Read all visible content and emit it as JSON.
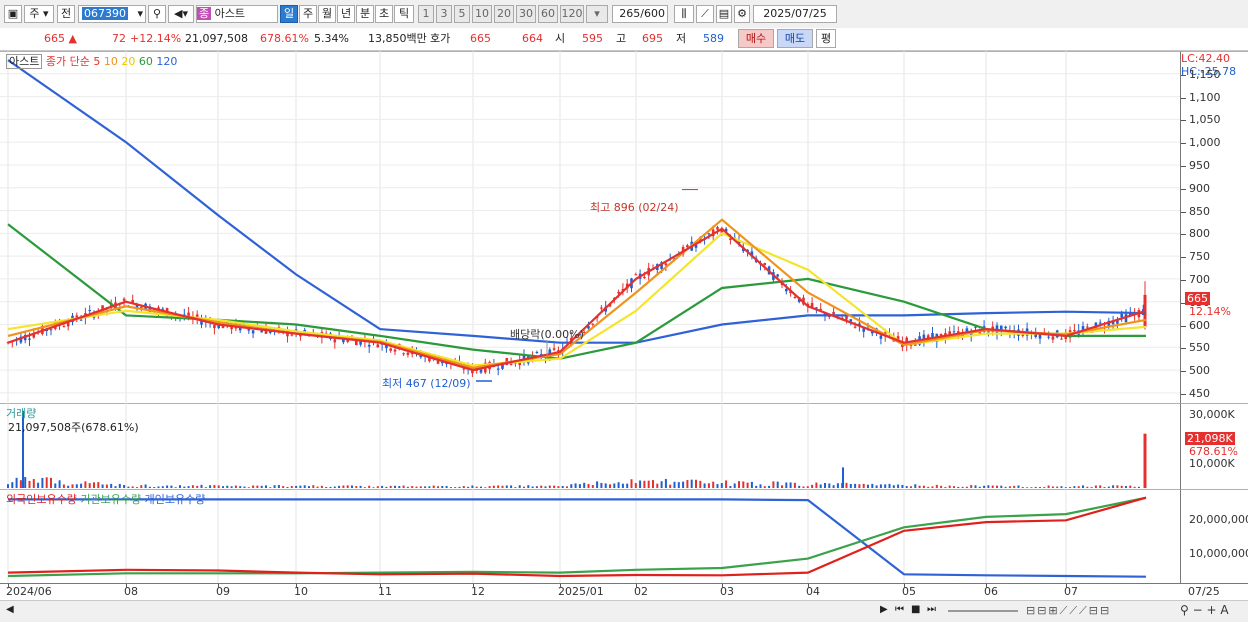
{
  "toolbar": {
    "period_label": "주",
    "prev_label": "전",
    "stock_code": "067390",
    "stock_name": "아스트",
    "stock_badge": "종",
    "tabs": [
      "일",
      "주",
      "월",
      "년",
      "분",
      "초",
      "틱"
    ],
    "active_tab": "일",
    "periods": [
      "1",
      "3",
      "5",
      "10",
      "20",
      "30",
      "60",
      "120"
    ],
    "count": "265",
    "count_total": "/600",
    "date": "2025/07/25"
  },
  "info": {
    "price": "665",
    "arrow": "▲",
    "change": "72",
    "change_pct": "+12.14%",
    "volume": "21,097,508",
    "volume_pct": "678.61%",
    "turnover": "5.34%",
    "amount": "13,850백만",
    "quote_label": "호가",
    "ask": "665",
    "bid": "664",
    "open_label": "시",
    "open": "595",
    "high_label": "고",
    "high": "695",
    "low_label": "저",
    "low": "589",
    "buy_label": "매수",
    "sell_label": "매도",
    "avg_label": "평"
  },
  "price_pane": {
    "name_label": "아스트",
    "series_label": "종가 단순",
    "ma_labels": [
      "5",
      "10",
      "20",
      "60",
      "120"
    ],
    "max_annotation": "최고 896 (02/24)",
    "min_annotation": "최저 467 (12/09)",
    "dividend_annotation": "배당락(0.00%)",
    "lc_label": "LC:42.40",
    "hc_label": "HC:-25.78",
    "price_tag": "665",
    "pct_tag": "12.14%",
    "y_labels": [
      "1,150",
      "1,100",
      "1,050",
      "1,000",
      "950",
      "900",
      "850",
      "800",
      "750",
      "700",
      "650",
      "600",
      "550",
      "500",
      "450"
    ]
  },
  "volume_pane": {
    "title": "거래량",
    "value_label": "21,097,508주(678.61%)",
    "tag_value": "21,098K",
    "tag_pct": "678.61%",
    "y_labels": [
      "30,000K",
      "10,000K"
    ]
  },
  "holdings_pane": {
    "legend": [
      "외국인보유수량",
      "기관보유수량",
      "개인보유수량"
    ],
    "y_labels": [
      "20,000,000",
      "10,000,000"
    ]
  },
  "x_axis": {
    "labels": [
      "2024/06",
      "08",
      "09",
      "10",
      "11",
      "12",
      "2025/01",
      "02",
      "03",
      "04",
      "05",
      "06",
      "07",
      "07/25"
    ]
  },
  "colors": {
    "up": "#e4312f",
    "down": "#1f5fd1",
    "ma5": "#e4312f",
    "ma10": "#f0931d",
    "ma20": "#f5e42b",
    "ma60": "#2a9a3a",
    "ma120": "#2f62d6",
    "foreign": "#e0201c",
    "institution": "#3ba24a",
    "individual": "#2f62d6"
  },
  "chart_data": [
    {
      "type": "line",
      "title": "아스트",
      "y_scale": "price (KRW)",
      "ylim": [
        430,
        1200
      ],
      "x": [
        "2024/06",
        "2024/08",
        "2024/09",
        "2024/10",
        "2024/11",
        "2024/12",
        "2025/01",
        "2025/02",
        "2025/03",
        "2025/04",
        "2025/05",
        "2025/06",
        "2025/07",
        "2025/07/25"
      ],
      "series": [
        {
          "name": "5",
          "values": [
            560,
            650,
            600,
            580,
            560,
            500,
            540,
            700,
            810,
            640,
            560,
            590,
            575,
            630
          ]
        },
        {
          "name": "10",
          "values": [
            575,
            640,
            605,
            580,
            562,
            505,
            535,
            670,
            830,
            670,
            555,
            588,
            578,
            610
          ]
        },
        {
          "name": "20",
          "values": [
            590,
            630,
            610,
            585,
            565,
            510,
            525,
            630,
            800,
            720,
            555,
            580,
            580,
            595
          ]
        },
        {
          "name": "60",
          "values": [
            820,
            620,
            610,
            600,
            575,
            545,
            525,
            560,
            680,
            700,
            650,
            590,
            575,
            575
          ]
        },
        {
          "name": "120",
          "values": [
            1180,
            1000,
            840,
            710,
            590,
            575,
            560,
            560,
            600,
            620,
            620,
            625,
            628,
            625
          ]
        }
      ],
      "annotations": [
        {
          "label": "최고 896 (02/24)",
          "x": "2025/02/24",
          "y": 896
        },
        {
          "label": "최저 467 (12/09)",
          "x": "2024/12/09",
          "y": 467
        },
        {
          "label": "배당락(0.00%)",
          "x": "2024/12/27",
          "y": 545
        }
      ]
    },
    {
      "type": "bar",
      "title": "거래량",
      "ylim": [
        0,
        33000
      ],
      "unit": "K",
      "x": [
        "2024/06",
        "2024/08",
        "2024/09",
        "2024/10",
        "2024/11",
        "2024/12",
        "2025/01",
        "2025/02",
        "2025/03",
        "2025/04",
        "2025/05",
        "2025/06",
        "2025/07",
        "2025/07/25"
      ],
      "values": [
        3200,
        900,
        700,
        700,
        600,
        600,
        700,
        2600,
        1800,
        1400,
        900,
        700,
        600,
        21098
      ]
    },
    {
      "type": "line",
      "title": "보유수량",
      "ylim": [
        0,
        25000000
      ],
      "x": [
        "2024/06",
        "2024/08",
        "2024/09",
        "2024/10",
        "2024/11",
        "2024/12",
        "2025/01",
        "2025/02",
        "2025/03",
        "2025/04",
        "2025/05",
        "2025/06",
        "2025/07",
        "2025/07/25"
      ],
      "series": [
        {
          "name": "외국인보유수량",
          "values": [
            3000000,
            3800000,
            3600000,
            3000000,
            2500000,
            2700000,
            2000000,
            2300000,
            2200000,
            3000000,
            15000000,
            17500000,
            18000000,
            24500000
          ]
        },
        {
          "name": "기관보유수량",
          "values": [
            2000000,
            2800000,
            2800000,
            2800000,
            3000000,
            3200000,
            3000000,
            3800000,
            4300000,
            7000000,
            16000000,
            19000000,
            19800000,
            24500000
          ]
        },
        {
          "name": "개인보유수량",
          "values": [
            24000000,
            24000000,
            24000000,
            24000000,
            24000000,
            24000000,
            24000000,
            24000000,
            24000000,
            23800000,
            2500000,
            2200000,
            2000000,
            1800000
          ]
        }
      ]
    }
  ]
}
